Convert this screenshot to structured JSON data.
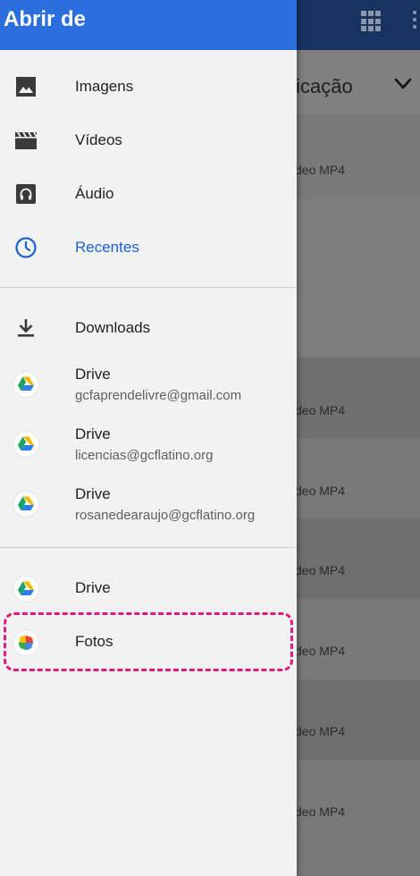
{
  "drawer": {
    "title": "Abrir de",
    "sections": [
      {
        "items": [
          {
            "label": "Imagens",
            "icon": "image-icon"
          },
          {
            "label": "Vídeos",
            "icon": "movie-icon"
          },
          {
            "label": "Áudio",
            "icon": "audio-icon"
          },
          {
            "label": "Recentes",
            "icon": "clock-icon",
            "active": true
          }
        ]
      },
      {
        "items": [
          {
            "label": "Downloads",
            "icon": "download-icon"
          },
          {
            "label": "Drive",
            "sublabel": "gcfaprendelivre@gmail.com",
            "icon": "google-drive-icon"
          },
          {
            "label": "Drive",
            "sublabel": "licencias@gcflatino.org",
            "icon": "google-drive-icon"
          },
          {
            "label": "Drive",
            "sublabel": "rosanedearaujo@gcflatino.org",
            "icon": "google-drive-icon"
          }
        ]
      },
      {
        "items": [
          {
            "label": "Drive",
            "icon": "google-drive-icon"
          },
          {
            "label": "Fotos",
            "icon": "google-photos-icon",
            "highlighted": true
          }
        ]
      }
    ]
  },
  "background": {
    "header_title": "ficação",
    "rows": [
      "deo MP4",
      "deo MP4",
      "deo MP4",
      "deo MP4",
      "deo MP4",
      "deo MP4",
      "deo MP4"
    ]
  },
  "colors": {
    "drawer_header": "#2b6fde",
    "active_item": "#1a63d5",
    "highlight": "#e0197c",
    "app_bar": "#17335f"
  }
}
